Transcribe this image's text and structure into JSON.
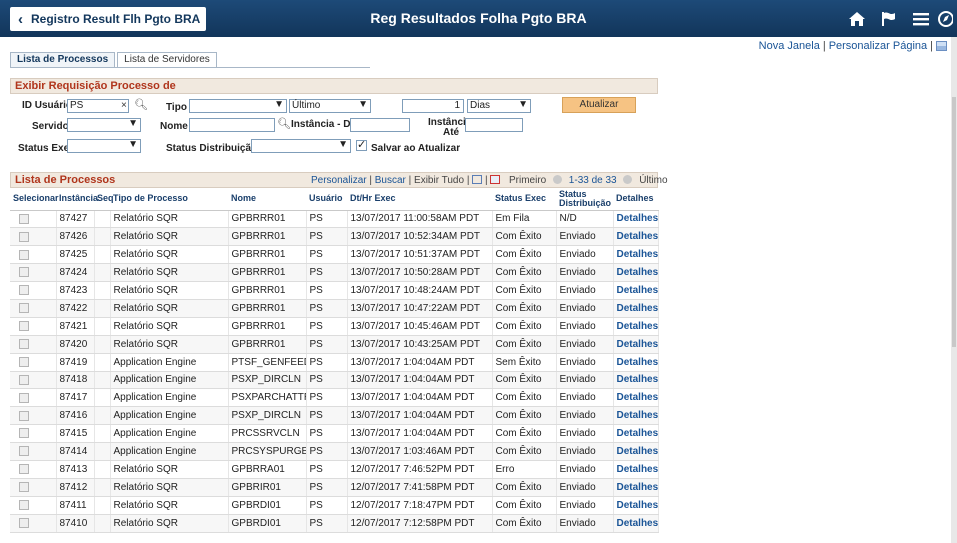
{
  "header": {
    "back_label": "Registro Result Flh Pgto BRA",
    "title": "Reg Resultados Folha Pgto BRA",
    "icons": [
      "home-icon",
      "flag-icon",
      "menu-icon",
      "compass-icon"
    ]
  },
  "toplinks": {
    "new_window": "Nova Janela",
    "separator": "|",
    "personalize_page": "Personalizar Página"
  },
  "tabs": [
    {
      "label": "Lista de Processos",
      "active": true
    },
    {
      "label": "Lista de Servidores",
      "active": false
    }
  ],
  "request": {
    "section_title": "Exibir Requisição Processo de",
    "user_id_label": "ID Usuário",
    "user_id_value": "PS",
    "tipo_label": "Tipo",
    "tipo_value": "",
    "periodo_value": "Último",
    "quantidade_value": "1",
    "unidade_value": "Dias",
    "refresh_label": "Atualizar",
    "servidor_label": "Servidor",
    "servidor_value": "",
    "nome_label": "Nome",
    "nome_value": "",
    "instancia_de_label": "Instância - De",
    "instancia_de_value": "",
    "instancia_ate_label_1": "Instância -",
    "instancia_ate_label_2": "Até",
    "instancia_ate_value": "",
    "status_exec_label": "Status Exec",
    "status_exec_value": "",
    "status_dist_label": "Status Distribuição",
    "status_dist_value": "",
    "salvar_label": "Salvar ao Atualizar",
    "salvar_checked": true
  },
  "grid": {
    "title": "Lista de Processos",
    "personalize": "Personalizar",
    "find": "Buscar",
    "view_all": "Exibir Tudo",
    "first": "Primeiro",
    "range": "1-33 de 33",
    "last": "Último",
    "columns": [
      "Selecionar",
      "Instância",
      "Seq",
      "Tipo de Processo",
      "Nome",
      "Usuário",
      "Dt/Hr Exec",
      "Status Exec",
      "Status Distribuição",
      "Detalhes"
    ],
    "rows": [
      {
        "inst": "87427",
        "seq": "",
        "tipo": "Relatório SQR",
        "nome": "GPBRRR01",
        "user": "PS",
        "dt": "13/07/2017 11:00:58AM PDT",
        "status": "Em Fila",
        "dist": "N/D",
        "det": "Detalhes"
      },
      {
        "inst": "87426",
        "seq": "",
        "tipo": "Relatório SQR",
        "nome": "GPBRRR01",
        "user": "PS",
        "dt": "13/07/2017 10:52:34AM PDT",
        "status": "Com Êxito",
        "dist": "Enviado",
        "det": "Detalhes"
      },
      {
        "inst": "87425",
        "seq": "",
        "tipo": "Relatório SQR",
        "nome": "GPBRRR01",
        "user": "PS",
        "dt": "13/07/2017 10:51:37AM PDT",
        "status": "Com Êxito",
        "dist": "Enviado",
        "det": "Detalhes"
      },
      {
        "inst": "87424",
        "seq": "",
        "tipo": "Relatório SQR",
        "nome": "GPBRRR01",
        "user": "PS",
        "dt": "13/07/2017 10:50:28AM PDT",
        "status": "Com Êxito",
        "dist": "Enviado",
        "det": "Detalhes"
      },
      {
        "inst": "87423",
        "seq": "",
        "tipo": "Relatório SQR",
        "nome": "GPBRRR01",
        "user": "PS",
        "dt": "13/07/2017 10:48:24AM PDT",
        "status": "Com Êxito",
        "dist": "Enviado",
        "det": "Detalhes"
      },
      {
        "inst": "87422",
        "seq": "",
        "tipo": "Relatório SQR",
        "nome": "GPBRRR01",
        "user": "PS",
        "dt": "13/07/2017 10:47:22AM PDT",
        "status": "Com Êxito",
        "dist": "Enviado",
        "det": "Detalhes"
      },
      {
        "inst": "87421",
        "seq": "",
        "tipo": "Relatório SQR",
        "nome": "GPBRRR01",
        "user": "PS",
        "dt": "13/07/2017 10:45:46AM PDT",
        "status": "Com Êxito",
        "dist": "Enviado",
        "det": "Detalhes"
      },
      {
        "inst": "87420",
        "seq": "",
        "tipo": "Relatório SQR",
        "nome": "GPBRRR01",
        "user": "PS",
        "dt": "13/07/2017 10:43:25AM PDT",
        "status": "Com Êxito",
        "dist": "Enviado",
        "det": "Detalhes"
      },
      {
        "inst": "87419",
        "seq": "",
        "tipo": "Application Engine",
        "nome": "PTSF_GENFEED",
        "user": "PS",
        "dt": "13/07/2017  1:04:04AM PDT",
        "status": "Sem Êxito",
        "dist": "Enviado",
        "det": "Detalhes"
      },
      {
        "inst": "87418",
        "seq": "",
        "tipo": "Application Engine",
        "nome": "PSXP_DIRCLN",
        "user": "PS",
        "dt": "13/07/2017  1:04:04AM PDT",
        "status": "Com Êxito",
        "dist": "Enviado",
        "det": "Detalhes"
      },
      {
        "inst": "87417",
        "seq": "",
        "tipo": "Application Engine",
        "nome": "PSXPARCHATTR",
        "user": "PS",
        "dt": "13/07/2017  1:04:04AM PDT",
        "status": "Com Êxito",
        "dist": "Enviado",
        "det": "Detalhes"
      },
      {
        "inst": "87416",
        "seq": "",
        "tipo": "Application Engine",
        "nome": "PSXP_DIRCLN",
        "user": "PS",
        "dt": "13/07/2017  1:04:04AM PDT",
        "status": "Com Êxito",
        "dist": "Enviado",
        "det": "Detalhes"
      },
      {
        "inst": "87415",
        "seq": "",
        "tipo": "Application Engine",
        "nome": "PRCSSRVCLN",
        "user": "PS",
        "dt": "13/07/2017  1:04:04AM PDT",
        "status": "Com Êxito",
        "dist": "Enviado",
        "det": "Detalhes"
      },
      {
        "inst": "87414",
        "seq": "",
        "tipo": "Application Engine",
        "nome": "PRCSYSPURGE",
        "user": "PS",
        "dt": "13/07/2017  1:03:46AM PDT",
        "status": "Com Êxito",
        "dist": "Enviado",
        "det": "Detalhes"
      },
      {
        "inst": "87413",
        "seq": "",
        "tipo": "Relatório SQR",
        "nome": "GPBRRA01",
        "user": "PS",
        "dt": "12/07/2017  7:46:52PM PDT",
        "status": "Erro",
        "dist": "Enviado",
        "det": "Detalhes"
      },
      {
        "inst": "87412",
        "seq": "",
        "tipo": "Relatório SQR",
        "nome": "GPBRIR01",
        "user": "PS",
        "dt": "12/07/2017  7:41:58PM PDT",
        "status": "Com Êxito",
        "dist": "Enviado",
        "det": "Detalhes"
      },
      {
        "inst": "87411",
        "seq": "",
        "tipo": "Relatório SQR",
        "nome": "GPBRDI01",
        "user": "PS",
        "dt": "12/07/2017  7:18:47PM PDT",
        "status": "Com Êxito",
        "dist": "Enviado",
        "det": "Detalhes"
      },
      {
        "inst": "87410",
        "seq": "",
        "tipo": "Relatório SQR",
        "nome": "GPBRDI01",
        "user": "PS",
        "dt": "12/07/2017  7:12:58PM PDT",
        "status": "Com Êxito",
        "dist": "Enviado",
        "det": "Detalhes"
      }
    ]
  }
}
